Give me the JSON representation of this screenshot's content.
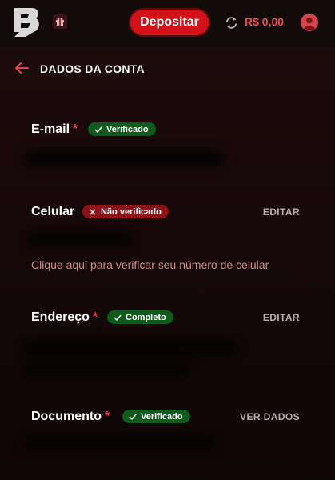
{
  "header": {
    "deposit_label": "Depositar",
    "balance": "R$ 0,00",
    "icons": {
      "logo": "logo-icon",
      "gift": "gift-icon",
      "refresh": "refresh-icon",
      "user": "user-icon"
    }
  },
  "page": {
    "title": "DADOS DA CONTA",
    "back_icon": "arrow-left-icon"
  },
  "sections": {
    "email": {
      "label": "E-mail",
      "required": "*",
      "badge": "Verificado"
    },
    "phone": {
      "label": "Celular",
      "badge": "Não verificado",
      "action": "EDITAR",
      "link": "Clique aqui para verificar seu número de celular"
    },
    "address": {
      "label": "Endereço",
      "required": "*",
      "badge": "Completo",
      "action": "EDITAR"
    },
    "document": {
      "label": "Documento",
      "required": "*",
      "badge": "Verificado",
      "action": "VER DADOS"
    }
  },
  "colors": {
    "accent": "#d11219",
    "balance": "#ef4c52",
    "verified": "#0f5a1d",
    "unverified": "#8d1116",
    "link": "#d48a8e"
  }
}
